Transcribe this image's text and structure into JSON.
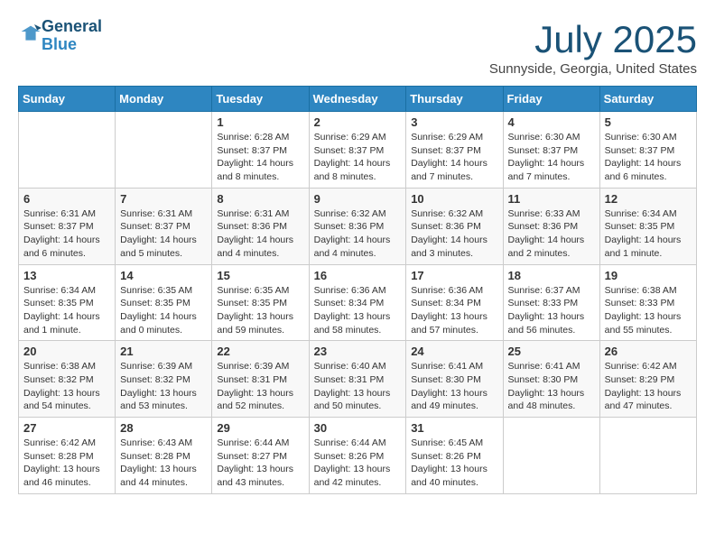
{
  "header": {
    "logo_line1": "General",
    "logo_line2": "Blue",
    "month_year": "July 2025",
    "location": "Sunnyside, Georgia, United States"
  },
  "weekdays": [
    "Sunday",
    "Monday",
    "Tuesday",
    "Wednesday",
    "Thursday",
    "Friday",
    "Saturday"
  ],
  "weeks": [
    [
      {
        "day": "",
        "info": ""
      },
      {
        "day": "",
        "info": ""
      },
      {
        "day": "1",
        "info": "Sunrise: 6:28 AM\nSunset: 8:37 PM\nDaylight: 14 hours and 8 minutes."
      },
      {
        "day": "2",
        "info": "Sunrise: 6:29 AM\nSunset: 8:37 PM\nDaylight: 14 hours and 8 minutes."
      },
      {
        "day": "3",
        "info": "Sunrise: 6:29 AM\nSunset: 8:37 PM\nDaylight: 14 hours and 7 minutes."
      },
      {
        "day": "4",
        "info": "Sunrise: 6:30 AM\nSunset: 8:37 PM\nDaylight: 14 hours and 7 minutes."
      },
      {
        "day": "5",
        "info": "Sunrise: 6:30 AM\nSunset: 8:37 PM\nDaylight: 14 hours and 6 minutes."
      }
    ],
    [
      {
        "day": "6",
        "info": "Sunrise: 6:31 AM\nSunset: 8:37 PM\nDaylight: 14 hours and 6 minutes."
      },
      {
        "day": "7",
        "info": "Sunrise: 6:31 AM\nSunset: 8:37 PM\nDaylight: 14 hours and 5 minutes."
      },
      {
        "day": "8",
        "info": "Sunrise: 6:31 AM\nSunset: 8:36 PM\nDaylight: 14 hours and 4 minutes."
      },
      {
        "day": "9",
        "info": "Sunrise: 6:32 AM\nSunset: 8:36 PM\nDaylight: 14 hours and 4 minutes."
      },
      {
        "day": "10",
        "info": "Sunrise: 6:32 AM\nSunset: 8:36 PM\nDaylight: 14 hours and 3 minutes."
      },
      {
        "day": "11",
        "info": "Sunrise: 6:33 AM\nSunset: 8:36 PM\nDaylight: 14 hours and 2 minutes."
      },
      {
        "day": "12",
        "info": "Sunrise: 6:34 AM\nSunset: 8:35 PM\nDaylight: 14 hours and 1 minute."
      }
    ],
    [
      {
        "day": "13",
        "info": "Sunrise: 6:34 AM\nSunset: 8:35 PM\nDaylight: 14 hours and 1 minute."
      },
      {
        "day": "14",
        "info": "Sunrise: 6:35 AM\nSunset: 8:35 PM\nDaylight: 14 hours and 0 minutes."
      },
      {
        "day": "15",
        "info": "Sunrise: 6:35 AM\nSunset: 8:35 PM\nDaylight: 13 hours and 59 minutes."
      },
      {
        "day": "16",
        "info": "Sunrise: 6:36 AM\nSunset: 8:34 PM\nDaylight: 13 hours and 58 minutes."
      },
      {
        "day": "17",
        "info": "Sunrise: 6:36 AM\nSunset: 8:34 PM\nDaylight: 13 hours and 57 minutes."
      },
      {
        "day": "18",
        "info": "Sunrise: 6:37 AM\nSunset: 8:33 PM\nDaylight: 13 hours and 56 minutes."
      },
      {
        "day": "19",
        "info": "Sunrise: 6:38 AM\nSunset: 8:33 PM\nDaylight: 13 hours and 55 minutes."
      }
    ],
    [
      {
        "day": "20",
        "info": "Sunrise: 6:38 AM\nSunset: 8:32 PM\nDaylight: 13 hours and 54 minutes."
      },
      {
        "day": "21",
        "info": "Sunrise: 6:39 AM\nSunset: 8:32 PM\nDaylight: 13 hours and 53 minutes."
      },
      {
        "day": "22",
        "info": "Sunrise: 6:39 AM\nSunset: 8:31 PM\nDaylight: 13 hours and 52 minutes."
      },
      {
        "day": "23",
        "info": "Sunrise: 6:40 AM\nSunset: 8:31 PM\nDaylight: 13 hours and 50 minutes."
      },
      {
        "day": "24",
        "info": "Sunrise: 6:41 AM\nSunset: 8:30 PM\nDaylight: 13 hours and 49 minutes."
      },
      {
        "day": "25",
        "info": "Sunrise: 6:41 AM\nSunset: 8:30 PM\nDaylight: 13 hours and 48 minutes."
      },
      {
        "day": "26",
        "info": "Sunrise: 6:42 AM\nSunset: 8:29 PM\nDaylight: 13 hours and 47 minutes."
      }
    ],
    [
      {
        "day": "27",
        "info": "Sunrise: 6:42 AM\nSunset: 8:28 PM\nDaylight: 13 hours and 46 minutes."
      },
      {
        "day": "28",
        "info": "Sunrise: 6:43 AM\nSunset: 8:28 PM\nDaylight: 13 hours and 44 minutes."
      },
      {
        "day": "29",
        "info": "Sunrise: 6:44 AM\nSunset: 8:27 PM\nDaylight: 13 hours and 43 minutes."
      },
      {
        "day": "30",
        "info": "Sunrise: 6:44 AM\nSunset: 8:26 PM\nDaylight: 13 hours and 42 minutes."
      },
      {
        "day": "31",
        "info": "Sunrise: 6:45 AM\nSunset: 8:26 PM\nDaylight: 13 hours and 40 minutes."
      },
      {
        "day": "",
        "info": ""
      },
      {
        "day": "",
        "info": ""
      }
    ]
  ]
}
